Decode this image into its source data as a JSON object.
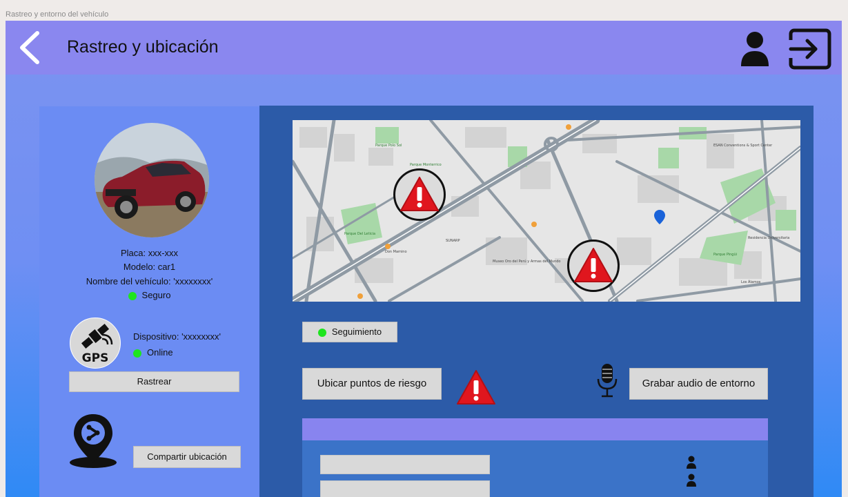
{
  "window": {
    "caption": "Rastreo y entorno del vehículo"
  },
  "header": {
    "title": "Rastreo y ubicación",
    "back_icon": "chevron-left-icon",
    "user_icon": "user-icon",
    "logout_icon": "logout-icon"
  },
  "vehicle": {
    "plate": "Placa: xxx-xxx",
    "model": "Modelo: car1",
    "name": "Nombre del vehículo: 'xxxxxxxx'",
    "status": "Seguro",
    "status_color": "#1ee51e"
  },
  "device": {
    "label": "Dispositivo: 'xxxxxxxx'",
    "status": "Online",
    "gps_text": "GPS",
    "track_button": "Rastrear"
  },
  "share": {
    "button": "Compartir ubicación",
    "icon": "share-location-pin-icon"
  },
  "map": {
    "labels": {
      "parque_polo": "Parque Polo Sol",
      "parque_monterrico": "Parque Monterrico",
      "parque_leticia": "Parque Del Leticia",
      "don_mamino": "Don Mamino",
      "sunarp": "SUNARP",
      "museo": "Museo Oro del Perú y Armas del Mundo",
      "parque_ps": "Parque Pingüi",
      "esan": "ESAN Conventions & Sport Center",
      "residencia": "Residencia Universitaria",
      "los_alamos": "Los Álamos"
    }
  },
  "actions": {
    "tracking": "Seguimiento",
    "tracking_color": "#1ee51e",
    "risk_points": "Ubicar puntos de riesgo",
    "record_audio": "Grabar audio de entorno",
    "warning_icon": "warning-icon",
    "mic_icon": "microphone-icon"
  },
  "colors": {
    "topbar": "#8a87ef",
    "left_panel": "#6b8cf3",
    "right_panel": "#2c5ba8",
    "warning_red": "#e0161e"
  }
}
